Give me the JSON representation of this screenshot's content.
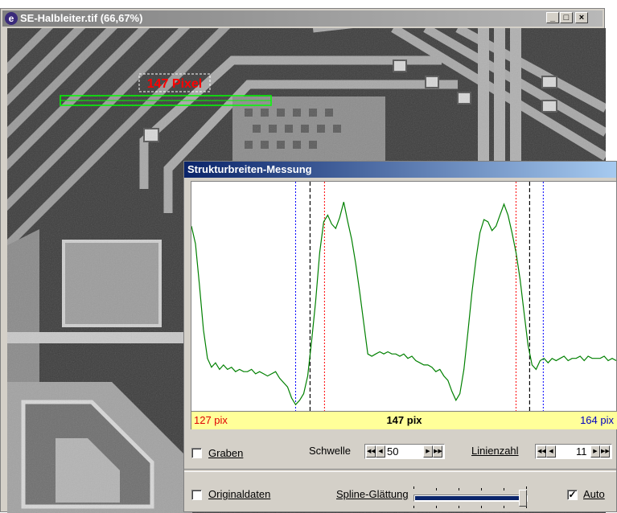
{
  "image_window": {
    "title": "SE-Halbleiter.tif (66,67%)",
    "app_icon_glyph": "e",
    "controls": {
      "minimize": "_",
      "maximize": "□",
      "close": "×"
    },
    "measurement_label": "147 Pixel",
    "label_color": "#ff0000",
    "measure_line_color": "#00ff00"
  },
  "measurement_window": {
    "title": "Strukturbreiten-Messung",
    "readout": {
      "left": "127 pix",
      "center": "147 pix",
      "right": "164 pix"
    },
    "controls": {
      "graben_label": "Graben",
      "graben_checked": false,
      "schwelle_label": "Schwelle",
      "schwelle_value": "50",
      "linienzahl_label": "Linienzahl",
      "linienzahl_value": "11",
      "originaldaten_label": "Originaldaten",
      "originaldaten_checked": false,
      "spline_label": "Spline-Glättung",
      "spline_level": 0.96,
      "auto_label": "Auto",
      "auto_checked": true
    },
    "colors": {
      "profile": "#008000",
      "edge_outer": "#0000ff",
      "edge_inner": "#ff0000",
      "edge_threshold": "#000000",
      "readout_bg": "#ffff99"
    }
  },
  "chart_data": {
    "type": "line",
    "title": "",
    "xlabel": "",
    "ylabel": "",
    "x": [
      0,
      5,
      10,
      15,
      20,
      25,
      30,
      35,
      40,
      45,
      50,
      55,
      60,
      65,
      70,
      75,
      80,
      85,
      90,
      95,
      100,
      105,
      110,
      115,
      120,
      125,
      130,
      135,
      140,
      145,
      150,
      155,
      160,
      165,
      170,
      175,
      180,
      185,
      190,
      195,
      200,
      205,
      210,
      215,
      220,
      225,
      230,
      235,
      240,
      245,
      250,
      255,
      260,
      265,
      270,
      275,
      280,
      285,
      290,
      295,
      300,
      305,
      310,
      315,
      320,
      325,
      330,
      335,
      340,
      345,
      350,
      355,
      360,
      365,
      370,
      375,
      380,
      385,
      390,
      395,
      400,
      405,
      410,
      415,
      420,
      425,
      430,
      435,
      440,
      445,
      450,
      455,
      460,
      465,
      470,
      475,
      480,
      485,
      490,
      495,
      500,
      505,
      510,
      515,
      520,
      525,
      530
    ],
    "values": [
      0.82,
      0.74,
      0.55,
      0.35,
      0.22,
      0.18,
      0.2,
      0.17,
      0.19,
      0.17,
      0.18,
      0.16,
      0.17,
      0.16,
      0.16,
      0.17,
      0.15,
      0.16,
      0.15,
      0.14,
      0.15,
      0.16,
      0.13,
      0.11,
      0.09,
      0.04,
      0.01,
      0.03,
      0.06,
      0.14,
      0.3,
      0.48,
      0.7,
      0.84,
      0.87,
      0.83,
      0.81,
      0.86,
      0.93,
      0.84,
      0.76,
      0.65,
      0.52,
      0.38,
      0.24,
      0.23,
      0.24,
      0.25,
      0.24,
      0.25,
      0.24,
      0.24,
      0.23,
      0.24,
      0.22,
      0.23,
      0.21,
      0.2,
      0.19,
      0.19,
      0.18,
      0.16,
      0.17,
      0.14,
      0.12,
      0.07,
      0.03,
      0.06,
      0.17,
      0.34,
      0.52,
      0.67,
      0.79,
      0.85,
      0.84,
      0.8,
      0.82,
      0.87,
      0.92,
      0.87,
      0.79,
      0.7,
      0.58,
      0.43,
      0.28,
      0.19,
      0.17,
      0.21,
      0.22,
      0.2,
      0.22,
      0.21,
      0.22,
      0.23,
      0.21,
      0.22,
      0.22,
      0.23,
      0.21,
      0.23,
      0.22,
      0.22,
      0.22,
      0.23,
      0.21,
      0.22,
      0.21
    ],
    "xlim": [
      0,
      530
    ],
    "ylim": [
      0,
      1
    ],
    "grid": false,
    "markers": [
      {
        "kind": "outer",
        "x": 130
      },
      {
        "kind": "threshold",
        "x": 148
      },
      {
        "kind": "inner",
        "x": 166
      },
      {
        "kind": "inner",
        "x": 405
      },
      {
        "kind": "threshold",
        "x": 422
      },
      {
        "kind": "outer",
        "x": 439
      }
    ]
  }
}
